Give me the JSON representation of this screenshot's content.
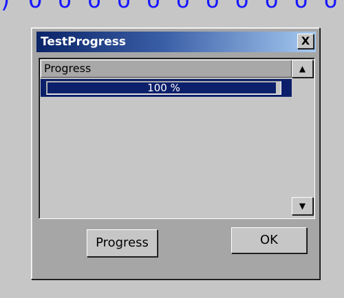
{
  "window": {
    "title": "TestProgress",
    "close_label": "X"
  },
  "list": {
    "column_header": "Progress",
    "rows": [
      {
        "progress_value": 1.0,
        "progress_text": "100 %"
      }
    ]
  },
  "scrollbar": {
    "up_icon": "scroll-up-arrow-icon",
    "down_icon": "scroll-down-arrow-icon"
  },
  "buttons": {
    "progress_label": "Progress",
    "ok_label": "OK"
  },
  "colors": {
    "titlebar_start": "#0a2468",
    "titlebar_end": "#a6caf0",
    "selection": "#0c1f6a",
    "face": "#c6c6c6"
  }
}
